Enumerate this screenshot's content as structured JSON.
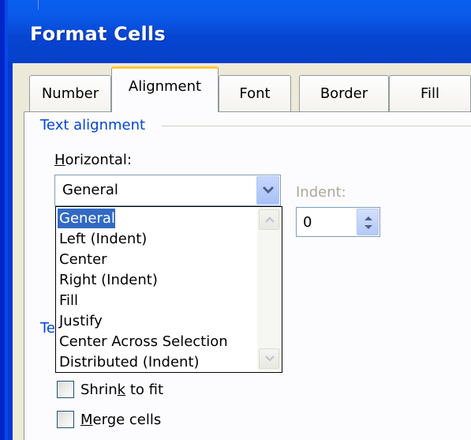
{
  "window": {
    "title": "Format Cells"
  },
  "tabs": [
    {
      "label": "Number"
    },
    {
      "label": "Alignment",
      "active": true
    },
    {
      "label": "Font"
    },
    {
      "label": "Border"
    },
    {
      "label": "Fill"
    }
  ],
  "text_alignment": {
    "group_label": "Text alignment",
    "horizontal_label_pre": "",
    "horizontal_label_key": "H",
    "horizontal_label_post": "orizontal:",
    "horizontal_value": "General",
    "indent_label": "Indent:",
    "indent_value": "0",
    "options": [
      "General",
      "Left (Indent)",
      "Center",
      "Right (Indent)",
      "Fill",
      "Justify",
      "Center Across Selection",
      "Distributed (Indent)"
    ],
    "selected_index": 0
  },
  "text_control": {
    "group_label_visible": "Te",
    "shrink_pre": "Shrin",
    "shrink_key": "k",
    "shrink_post": " to fit",
    "merge_pre": "",
    "merge_key": "M",
    "merge_post": "erge cells",
    "shrink_checked": false,
    "merge_checked": false
  },
  "colors": {
    "title_bar": "#0a5ff0",
    "selection": "#316ac5",
    "group_label": "#0046d5",
    "active_tab_accent": "#ffc83c"
  }
}
